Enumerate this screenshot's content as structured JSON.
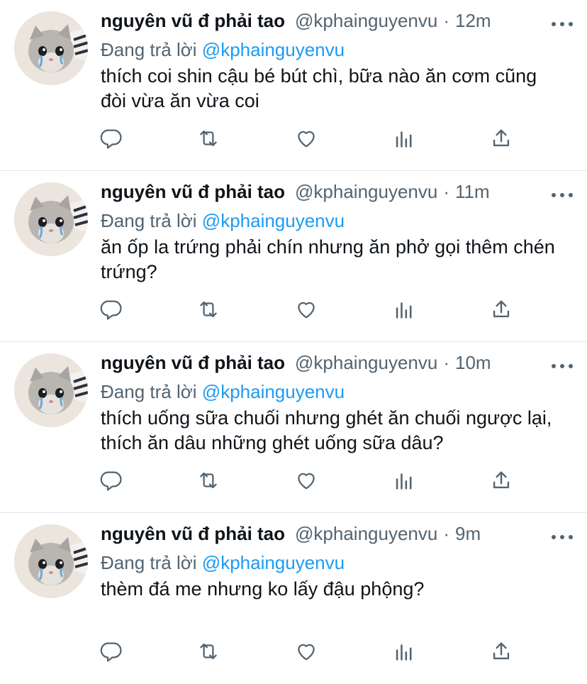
{
  "feed": {
    "tweets": [
      {
        "display_name": "nguyên vũ đ phải tao",
        "handle": "@kphainguyenvu",
        "separator": "·",
        "time": "12m",
        "reply_prefix": "Đang trả lời",
        "reply_to": "@kphainguyenvu",
        "text": "thích coi shin cậu bé bút chì, bữa nào ăn cơm cũng đòi vừa ăn vừa coi"
      },
      {
        "display_name": "nguyên vũ đ phải tao",
        "handle": "@kphainguyenvu",
        "separator": "·",
        "time": "11m",
        "reply_prefix": "Đang trả lời",
        "reply_to": "@kphainguyenvu",
        "text": "ăn ốp la trứng phải chín nhưng ăn phở gọi thêm chén trứng?"
      },
      {
        "display_name": "nguyên vũ đ phải tao",
        "handle": "@kphainguyenvu",
        "separator": "·",
        "time": "10m",
        "reply_prefix": "Đang trả lời",
        "reply_to": "@kphainguyenvu",
        "text": "thích uống sữa chuối nhưng ghét ăn chuối ngược lại, thích ăn dâu những ghét uống sữa dâu?"
      },
      {
        "display_name": "nguyên vũ đ phải tao",
        "handle": "@kphainguyenvu",
        "separator": "·",
        "time": "9m",
        "reply_prefix": "Đang trả lời",
        "reply_to": "@kphainguyenvu",
        "text": "thèm đá me nhưng ko lấy đậu phộng?"
      }
    ]
  },
  "icons": {
    "reply": "reply-icon",
    "retweet": "retweet-icon",
    "like": "heart-icon",
    "analytics": "analytics-icon",
    "share": "share-icon",
    "more": "more-options-icon"
  },
  "colors": {
    "text": "#0f1419",
    "secondary": "#536471",
    "link": "#1d9bf0",
    "divider": "#e6e6e6"
  }
}
